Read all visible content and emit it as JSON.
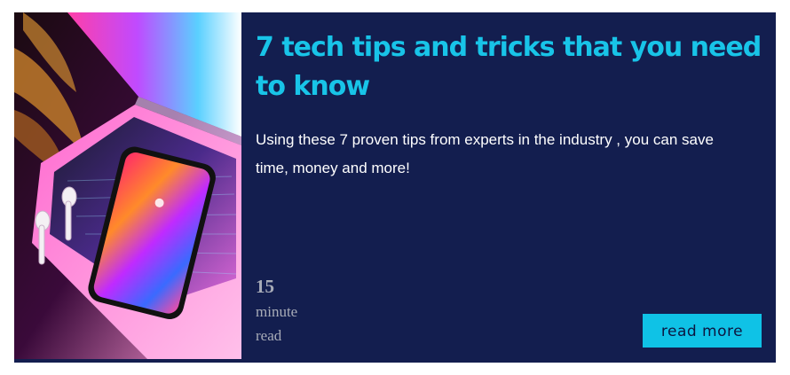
{
  "article": {
    "title": "7 tech tips and tricks that you need to know",
    "description": "Using these 7 proven tips from experts in the industry , you can save time, money and more!",
    "read_time": {
      "value": "15",
      "unit_line1": "minute",
      "unit_line2": "read"
    },
    "read_more_label": "read more",
    "image_icon": "laptop-phone-photo"
  },
  "colors": {
    "card_background": "#131e4f",
    "title": "#18c4e8",
    "button": "#0fc2e6",
    "read_time_text": "#a8acb8"
  }
}
